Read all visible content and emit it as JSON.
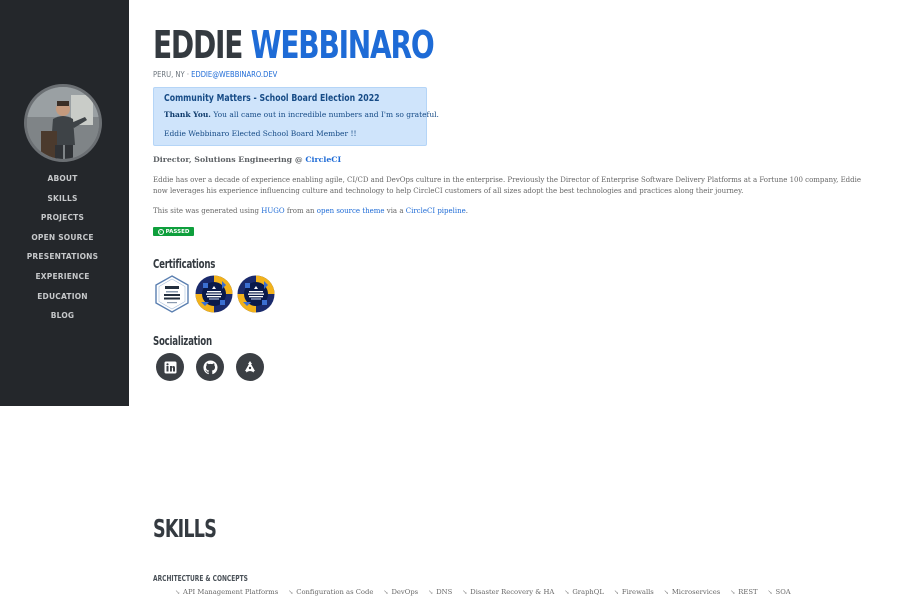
{
  "sidebar": {
    "nav": [
      {
        "label": "ABOUT"
      },
      {
        "label": "SKILLS"
      },
      {
        "label": "PROJECTS"
      },
      {
        "label": "OPEN SOURCE"
      },
      {
        "label": "PRESENTATIONS"
      },
      {
        "label": "EXPERIENCE"
      },
      {
        "label": "EDUCATION"
      },
      {
        "label": "BLOG"
      }
    ]
  },
  "header": {
    "first_name": "EDDIE",
    "last_name": "WEBBINARO",
    "location": "PERU, NY · ",
    "email": "EDDIE@WEBBINARO.DEV"
  },
  "alert": {
    "title": "Community Matters - School Board Election 2022",
    "thanks": "Thank You.",
    "message": " You all came out in incredible numbers and I'm so grateful.",
    "line2": "Eddie Webbinaro Elected School Board Member !!"
  },
  "about": {
    "role_prefix": "Director, Solutions Engineering @ ",
    "role_company": "CircleCI",
    "bio": "Eddie has over a decade of experience enabling agile, CI/CD and DevOps culture in the enterprise. Previously the Director of Enterprise Software Delivery Platforms at a Fortune 100 company, Eddie now leverages his experience influencing culture and technology to help CircleCI customers of all sizes adopt the best technologies and practices along their journey.",
    "gen_prefix": "This site was generated using ",
    "gen_hugo": "HUGO",
    "gen_mid": " from an ",
    "gen_theme": "open source theme",
    "gen_via": " via a ",
    "gen_pipeline": "CircleCI pipeline",
    "gen_end": ".",
    "badge_text": "PASSED"
  },
  "certifications": {
    "title": "Certifications"
  },
  "socialization": {
    "title": "Socialization",
    "icons": [
      "linkedin-icon",
      "github-icon",
      "codewars-icon"
    ]
  },
  "skills": {
    "title": "SKILLS",
    "category": "ARCHITECTURE & CONCEPTS",
    "items": [
      "API Management Platforms",
      "Configuration as Code",
      "DevOps",
      "DNS",
      "Disaster Recovery & HA",
      "GraphQL",
      "Firewalls",
      "Microservices",
      "REST",
      "SOA"
    ]
  },
  "colors": {
    "sidebar_bg": "#24272b",
    "accent": "#1e6bd6",
    "alert_bg": "#cfe4fb",
    "badge_green": "#0e9f3c"
  }
}
